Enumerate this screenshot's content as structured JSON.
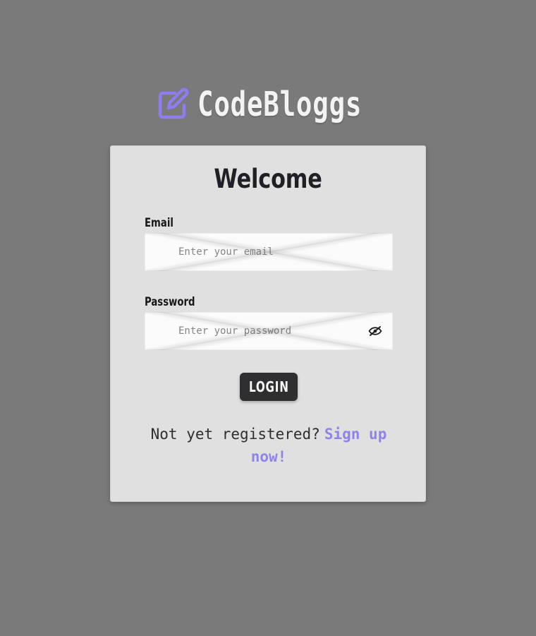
{
  "brand": {
    "name": "CodeBloggs",
    "icon": "edit-icon",
    "icon_color": "#8e7cf1",
    "text_color": "#f3f3f3"
  },
  "login_card": {
    "title": "Welcome",
    "email": {
      "label": "Email",
      "placeholder": "Enter your email",
      "value": ""
    },
    "password": {
      "label": "Password",
      "placeholder": "Enter your password",
      "value": "",
      "toggle_icon": "eye-off-icon"
    },
    "login_button_label": "LOGIN",
    "register_prompt": "Not yet registered?",
    "signup_link_label": "Sign up now!"
  },
  "colors": {
    "page_background": "#7a7a7a",
    "card_background": "#e0e0e0",
    "accent": "#8e84e8",
    "button_background": "#2f2f31"
  }
}
